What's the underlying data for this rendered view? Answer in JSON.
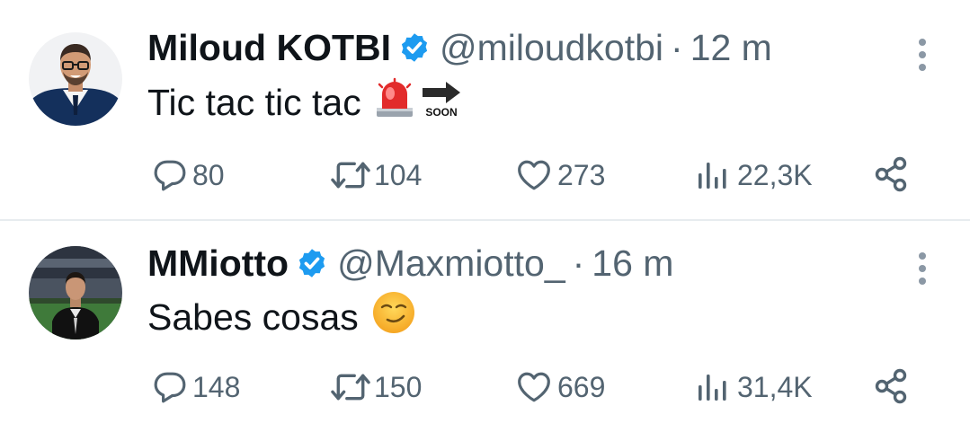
{
  "tweets": [
    {
      "name": "Miloud KOTBI",
      "handle": "@miloudkotbi",
      "separator": "·",
      "time": "12 m",
      "text": "Tic tac tic tac",
      "emoji_label": "SOON",
      "stats": {
        "replies": "80",
        "retweets": "104",
        "likes": "273",
        "views": "22,3K"
      }
    },
    {
      "name": "MMiotto",
      "handle": "@Maxmiotto_",
      "separator": "·",
      "time": "16 m",
      "text": "Sabes cosas",
      "stats": {
        "replies": "148",
        "retweets": "150",
        "likes": "669",
        "views": "31,4K"
      }
    }
  ],
  "colors": {
    "verified": "#1d9bf0",
    "muted": "#536471",
    "divider": "#e7ecef"
  },
  "icons": [
    "verified-badge-icon",
    "more-icon",
    "reply-icon",
    "retweet-icon",
    "like-icon",
    "views-icon",
    "share-icon"
  ]
}
